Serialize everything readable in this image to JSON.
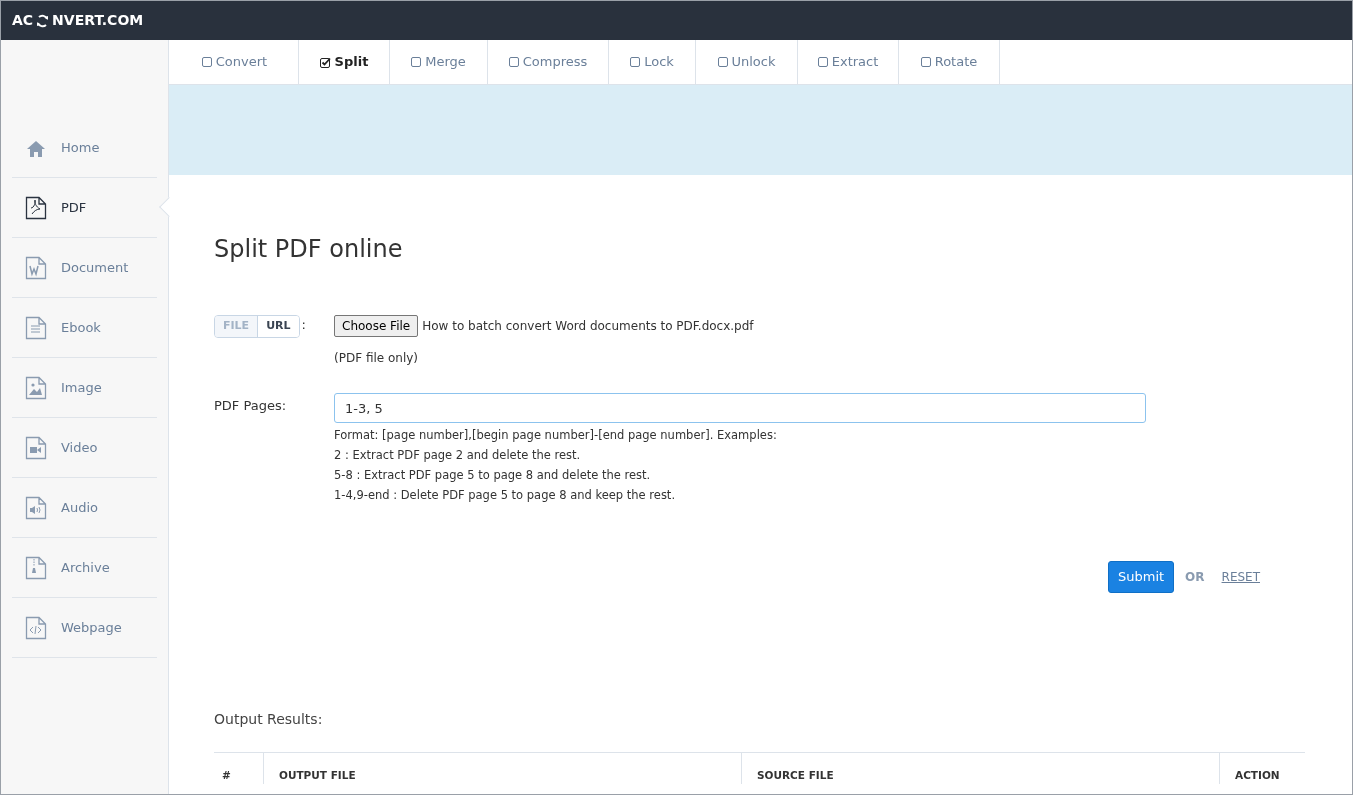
{
  "logo": {
    "left": "AC",
    "right": "NVERT.COM"
  },
  "tabs": [
    {
      "label": "Convert",
      "selected": false
    },
    {
      "label": "Split",
      "selected": true
    },
    {
      "label": "Merge",
      "selected": false
    },
    {
      "label": "Compress",
      "selected": false
    },
    {
      "label": "Lock",
      "selected": false
    },
    {
      "label": "Unlock",
      "selected": false
    },
    {
      "label": "Extract",
      "selected": false
    },
    {
      "label": "Rotate",
      "selected": false
    }
  ],
  "sidebar": {
    "items": [
      {
        "kind": "home",
        "label": "Home",
        "selected": false
      },
      {
        "kind": "pdf",
        "label": "PDF",
        "selected": true
      },
      {
        "kind": "document",
        "label": "Document",
        "selected": false
      },
      {
        "kind": "ebook",
        "label": "Ebook",
        "selected": false
      },
      {
        "kind": "image",
        "label": "Image",
        "selected": false
      },
      {
        "kind": "video",
        "label": "Video",
        "selected": false
      },
      {
        "kind": "audio",
        "label": "Audio",
        "selected": false
      },
      {
        "kind": "archive",
        "label": "Archive",
        "selected": false
      },
      {
        "kind": "webpage",
        "label": "Webpage",
        "selected": false
      }
    ]
  },
  "title": "Split PDF online",
  "source": {
    "modes": [
      {
        "label": "FILE",
        "selected": true
      },
      {
        "label": "URL",
        "selected": false
      }
    ],
    "colon": ":",
    "button": "Choose File",
    "file_name": "How to batch convert Word documents to PDF.docx.pdf",
    "note": "(PDF file only)"
  },
  "pages": {
    "label": "PDF Pages:",
    "value": "1-3, 5",
    "help": [
      "Format: [page number],[begin page number]-[end page number]. Examples:",
      "2 : Extract PDF page 2 and delete the rest.",
      "5-8 : Extract PDF page 5 to page 8 and delete the rest.",
      "1-4,9-end : Delete PDF page 5 to page 8 and keep the rest."
    ]
  },
  "actions": {
    "submit": "Submit",
    "or": "OR",
    "reset": "RESET"
  },
  "output": {
    "title": "Output Results:",
    "columns": [
      "#",
      "OUTPUT FILE",
      "SOURCE FILE",
      "ACTION"
    ]
  }
}
